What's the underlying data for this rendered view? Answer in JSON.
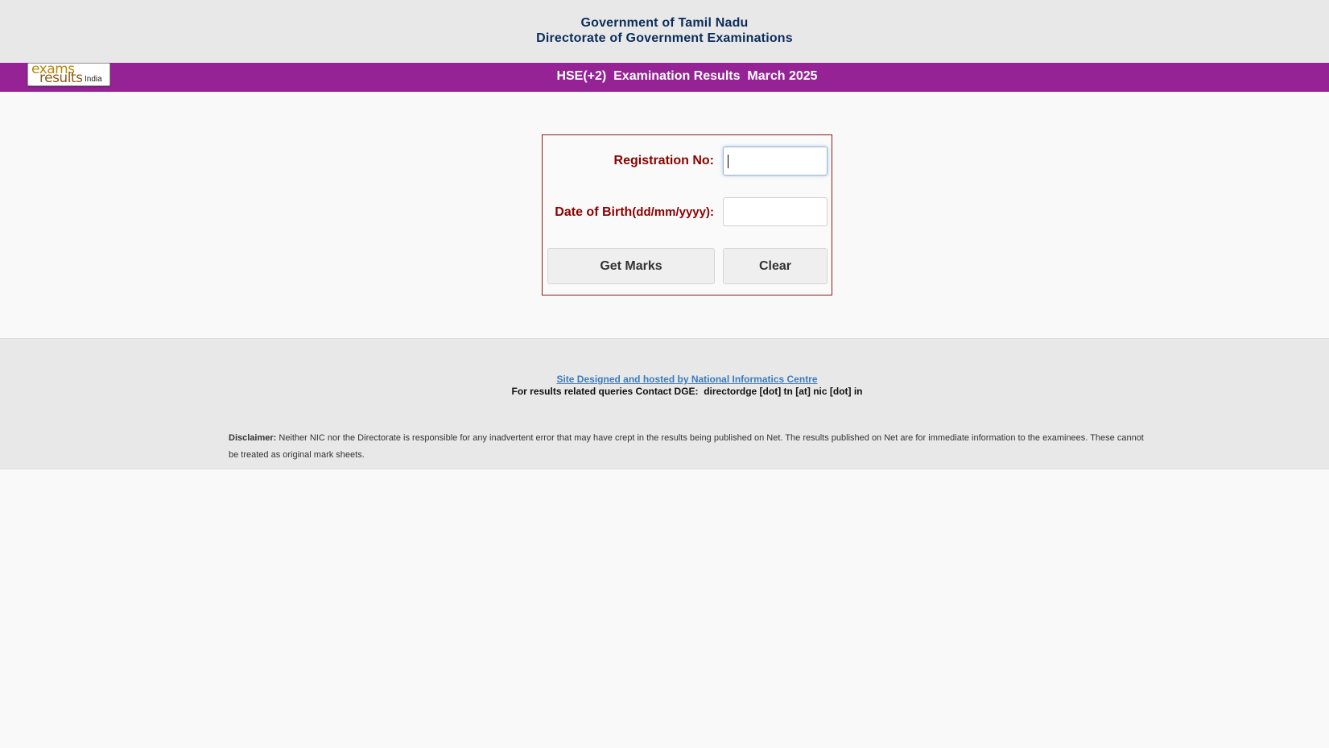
{
  "header": {
    "line1": "Government of Tamil Nadu",
    "line2": "Directorate of Government Examinations"
  },
  "banner": {
    "title": "HSE(+2)  Examination Results  March 2025",
    "background": "#952396"
  },
  "logo": {
    "line1": "exams",
    "line2": "results",
    "line3": "India"
  },
  "form": {
    "registration_label": "Registration No:",
    "registration_value": "",
    "dob_label_main": "Date of Birth",
    "dob_label_format": "(dd/mm/yyyy):",
    "dob_value": "",
    "get_marks_label": "Get Marks",
    "clear_label": "Clear"
  },
  "footer": {
    "nic_link": "Site Designed and hosted by National Informatics Centre",
    "contact": "For results related queries Contact DGE:  directordge [dot] tn [at] nic [dot] in",
    "disclaimer_label": "Disclaimer:",
    "disclaimer_text": " Neither NIC nor the Directorate is responsible for any inadvertent error that may have crept in the results being published on Net. The results published on Net are for immediate information to the examinees. These cannot be treated as original mark sheets."
  },
  "colors": {
    "header_text": "#0b2d5c",
    "label_text": "#8b0000",
    "link": "#3a7bbf"
  }
}
